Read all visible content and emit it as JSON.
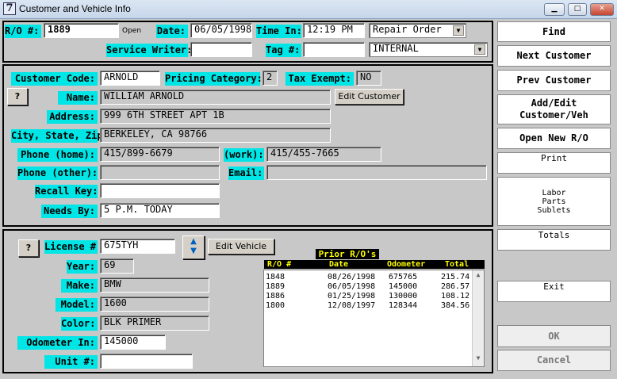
{
  "window": {
    "title": "Customer and Vehicle Info",
    "app_icon": "7"
  },
  "header": {
    "ro_label": "R/O #:",
    "ro_value": "1889",
    "ro_status": "Open",
    "date_label": "Date:",
    "date_value": "06/05/1998",
    "time_label": "Time In:",
    "time_value": "12:19 PM",
    "type_select": "Repair Order",
    "service_writer_label": "Service Writer:",
    "service_writer_value": "",
    "tag_label": "Tag #:",
    "tag_value": "",
    "account_select": "INTERNAL"
  },
  "customer": {
    "code_label": "Customer Code:",
    "code_value": "ARNOLD",
    "pricing_label": "Pricing Category:",
    "pricing_value": "2",
    "tax_label": "Tax Exempt:",
    "tax_value": "NO",
    "help_label": "?",
    "name_label": "Name:",
    "name_value": "WILLIAM ARNOLD",
    "edit_customer": "Edit Customer",
    "address_label": "Address:",
    "address_value": "999 6TH STREET APT 1B",
    "city_label": "City, State, Zip:",
    "city_value": "BERKELEY, CA  98766",
    "phone_home_label": "Phone (home):",
    "phone_home_value": "415/899-6679",
    "work_label": "(work):",
    "work_value": "415/455-7665",
    "phone_other_label": "Phone (other):",
    "phone_other_value": "",
    "email_label": "Email:",
    "email_value": "",
    "recall_label": "Recall Key:",
    "recall_value": "",
    "needs_label": "Needs By:",
    "needs_value": "5 P.M. TODAY"
  },
  "vehicle": {
    "help_label": "?",
    "license_label": "License #",
    "license_value": "675TYH",
    "edit_vehicle": "Edit Vehicle",
    "year_label": "Year:",
    "year_value": "69",
    "make_label": "Make:",
    "make_value": "BMW",
    "model_label": "Model:",
    "model_value": "1600",
    "color_label": "Color:",
    "color_value": "BLK PRIMER",
    "odometer_label": "Odometer In:",
    "odometer_value": "145000",
    "unit_label": "Unit #:",
    "unit_value": ""
  },
  "prior_ros": {
    "title": "Prior R/O's",
    "columns": [
      "R/O #",
      "Date",
      "Odometer",
      "Total"
    ],
    "rows": [
      [
        "1848",
        "08/26/1998",
        "675765",
        "215.74"
      ],
      [
        "1889",
        "06/05/1998",
        "145000",
        "286.57"
      ],
      [
        "1886",
        "01/25/1998",
        "130000",
        "108.12"
      ],
      [
        "1800",
        "12/08/1997",
        "128344",
        "384.56"
      ]
    ]
  },
  "sidebar": {
    "find": "Find",
    "next_customer": "Next Customer",
    "prev_customer": "Prev Customer",
    "add_edit_1": "Add/Edit",
    "add_edit_2": "Customer/Veh",
    "open_new_ro": "Open New R/O",
    "print": "Print",
    "lps_1": "Labor",
    "lps_2": "Parts",
    "lps_3": "Sublets",
    "totals": "Totals",
    "exit": "Exit",
    "ok": "OK",
    "cancel": "Cancel"
  },
  "colors": {
    "label_bg": "#00e5e5",
    "list_header_bg": "#000000",
    "list_header_fg": "#ffff00"
  }
}
